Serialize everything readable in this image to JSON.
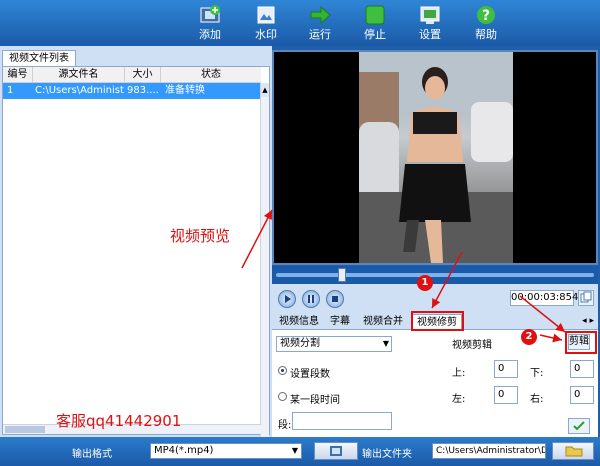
{
  "toolbar": {
    "buttons": [
      {
        "id": "add",
        "label": "添加",
        "icon": "film-add-icon"
      },
      {
        "id": "watermark",
        "label": "水印",
        "icon": "watermark-icon"
      },
      {
        "id": "run",
        "label": "运行",
        "icon": "arrow-right-icon"
      },
      {
        "id": "stop",
        "label": "停止",
        "icon": "stop-icon"
      },
      {
        "id": "settings",
        "label": "设置",
        "icon": "settings-icon"
      },
      {
        "id": "help",
        "label": "帮助",
        "icon": "help-icon"
      }
    ]
  },
  "file_list": {
    "tab_label": "视频文件列表",
    "columns": [
      "编号",
      "源文件名",
      "大小",
      "状态"
    ],
    "rows": [
      {
        "index": "1",
        "filename": "C:\\Users\\Administ...",
        "size": "983....",
        "status": "准备转换"
      }
    ]
  },
  "player": {
    "time": "00:00:03:854"
  },
  "edit_tabs": {
    "tabs": [
      "视频信息",
      "字幕",
      "视频合并",
      "视频修剪"
    ],
    "active": "视频修剪",
    "arrows": "◂ ▸"
  },
  "trim_panel": {
    "mode_select": "视频分割",
    "options": [
      "设置段数",
      "某一段时间"
    ],
    "selected_option": "设置段数",
    "segment_label": "段:",
    "segment_value": "",
    "crop_title": "视频剪辑",
    "crop_fields": [
      {
        "label": "上:",
        "value": "0"
      },
      {
        "label": "下:",
        "value": "0"
      },
      {
        "label": "左:",
        "value": "0"
      },
      {
        "label": "右:",
        "value": "0"
      }
    ],
    "crop_button": "剪辑"
  },
  "bottom_bar": {
    "format_label": "输出格式",
    "format_value": "MP4(*.mp4)",
    "folder_label": "输出文件夹",
    "folder_path": "C:\\Users\\Administrator\\De:"
  },
  "annotations": {
    "preview_caption": "视频预览",
    "contact": "客服qq41442901",
    "badge_1": "1",
    "badge_2": "2"
  },
  "colors": {
    "toolbar_blue": "#1b5aa8",
    "panel_blue": "#cfe0f5",
    "selection_blue": "#3399ff",
    "annotation_red": "#e01010"
  }
}
